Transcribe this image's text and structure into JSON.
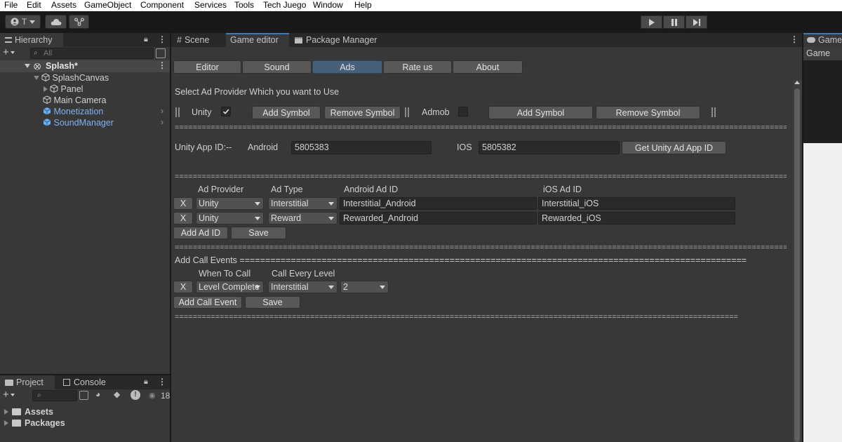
{
  "menu": [
    "File",
    "Edit",
    "Assets",
    "GameObject",
    "Component",
    "Services",
    "Tools",
    "Tech Juego",
    "Window",
    "Help"
  ],
  "toolbar": {
    "account_label": "T"
  },
  "hierarchy": {
    "tab_label": "Hierarchy",
    "search_placeholder": "All",
    "scene_name": "Splash*",
    "items": [
      {
        "label": "SplashCanvas",
        "prefab": false
      },
      {
        "label": "Panel",
        "prefab": false
      },
      {
        "label": "Main Camera",
        "prefab": false
      },
      {
        "label": "Monetization",
        "prefab": true
      },
      {
        "label": "SoundManager",
        "prefab": true
      }
    ]
  },
  "project": {
    "tabs": [
      "Project",
      "Console"
    ],
    "badge_count": "18",
    "folders": [
      "Assets",
      "Packages"
    ]
  },
  "center_tabs": [
    "Scene",
    "Game editor",
    "Package Manager"
  ],
  "right_tab": {
    "label": "Game",
    "dropdown": "Game"
  },
  "editor": {
    "tabs": [
      "Editor",
      "Sound",
      "Ads",
      "Rate us",
      "About"
    ],
    "selected_tab": "Ads",
    "heading": "Select Ad Provider Which you want to Use",
    "providers": [
      {
        "name": "Unity",
        "checked": true,
        "add_label": "Add  Symbol",
        "remove_label": "Remove Symbol"
      },
      {
        "name": "Admob",
        "checked": false,
        "add_label": "Add  Symbol",
        "remove_label": "Remove Symbol"
      }
    ],
    "separator": "===============================================================================================================================================================",
    "separator_short": "=============================================================================================================================",
    "app_id": {
      "label": "Unity App ID:--",
      "android_label": "Android",
      "android_value": "5805383",
      "ios_label": "IOS",
      "ios_value": "5805382",
      "get_button": "Get Unity Ad App ID"
    },
    "ads_table": {
      "headers": [
        "Ad Provider",
        "Ad Type",
        "Android Ad ID",
        "iOS Ad ID"
      ],
      "rows": [
        {
          "remove": "X",
          "provider": "Unity",
          "type": "Interstitial",
          "android": "Interstitial_Android",
          "ios": "Interstitial_iOS"
        },
        {
          "remove": "X",
          "provider": "Unity",
          "type": "Reward",
          "android": "Rewarded_Android",
          "ios": "Rewarded_iOS"
        }
      ],
      "add_button": "Add Ad ID",
      "save_button": "Save"
    },
    "call_events": {
      "title": "Add Call Events ===================================================================================================",
      "headers": [
        "When To Call",
        "Call Every Level"
      ],
      "rows": [
        {
          "remove": "X",
          "when": "Level Complete",
          "type": "Interstitial",
          "every": "2"
        }
      ],
      "add_button": "Add Call Event",
      "save_button": "Save"
    }
  },
  "colors": {
    "selected_tab": "#46607c",
    "prefab_blue": "#7fb2ee",
    "panel_bg": "#383838",
    "toolbar_bg": "#191919"
  }
}
